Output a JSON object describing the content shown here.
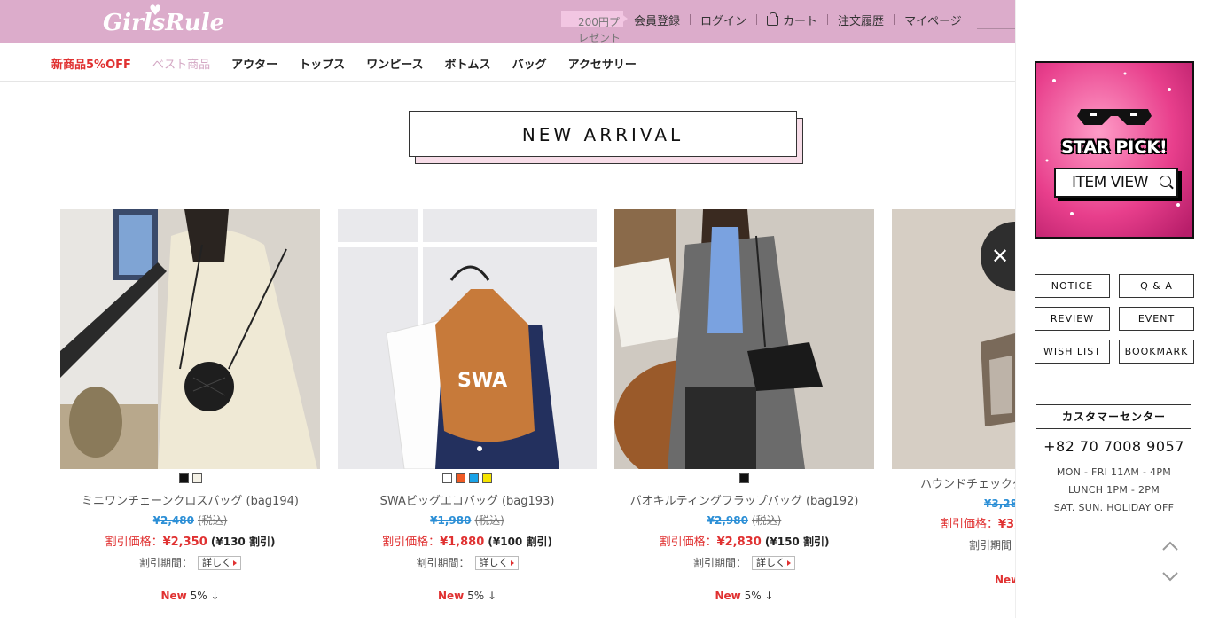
{
  "header": {
    "logo_text": "GirlsRule",
    "gift_text": "200円プレゼント",
    "links": [
      "会員登録",
      "ログイン",
      "カート",
      "注文履歴",
      "マイページ"
    ]
  },
  "categories": [
    "新商品5%OFF",
    "ベスト商品",
    "アウター",
    "トップス",
    "ワンピース",
    "ボトムス",
    "バッグ",
    "アクセサリー"
  ],
  "section_title": "NEW ARRIVAL",
  "products": [
    {
      "name": "ミニワンチェーンクロスバッグ (bag194)",
      "orig_price": "¥2,480",
      "tax": "(税込)",
      "sale_label": "割引価格：",
      "sale_price": "¥2,350",
      "discount": "(¥130 割引)",
      "period_label": "割引期間：",
      "detail": "詳しく",
      "new_label": "New",
      "new_pct": "5% ↓",
      "swatches": [
        "#111111",
        "#f4f1e6"
      ]
    },
    {
      "name": "SWAビッグエコバッグ (bag193)",
      "orig_price": "¥1,980",
      "tax": "(税込)",
      "sale_label": "割引価格：",
      "sale_price": "¥1,880",
      "discount": "(¥100 割引)",
      "period_label": "割引期間：",
      "detail": "詳しく",
      "new_label": "New",
      "new_pct": "5% ↓",
      "swatches": [
        "#ffffff",
        "#ef5a24",
        "#1aa3e8",
        "#f5e400"
      ]
    },
    {
      "name": "バオキルティングフラップバッグ (bag192)",
      "orig_price": "¥2,980",
      "tax": "(税込)",
      "sale_label": "割引価格：",
      "sale_price": "¥2,830",
      "discount": "(¥150 割引)",
      "period_label": "割引期間：",
      "detail": "詳しく",
      "new_label": "New",
      "new_pct": "5% ↓",
      "swatches": [
        "#111111"
      ]
    },
    {
      "name": "ハウンドチェックク",
      "orig_price": "¥3,28",
      "sale_label": "割引価格：",
      "sale_price": "¥3,",
      "period_label": "割引期間",
      "new_label": "New"
    }
  ],
  "sidebar": {
    "banner_title": "STAR PICK!",
    "banner_button": "ITEM VIEW",
    "buttons": [
      "NOTICE",
      "Q & A",
      "REVIEW",
      "EVENT",
      "WISH LIST",
      "BOOKMARK"
    ],
    "cs_title": "カスタマーセンター",
    "phone": "+82 70 7008 9057",
    "hours": [
      "MON - FRI 11AM - 4PM",
      "LUNCH 1PM - 2PM",
      "SAT. SUN. HOLIDAY OFF"
    ]
  },
  "colors": {
    "header_bg": "#dcaccb",
    "sale_red": "#e03131",
    "price_blue": "#2c8fd6"
  }
}
